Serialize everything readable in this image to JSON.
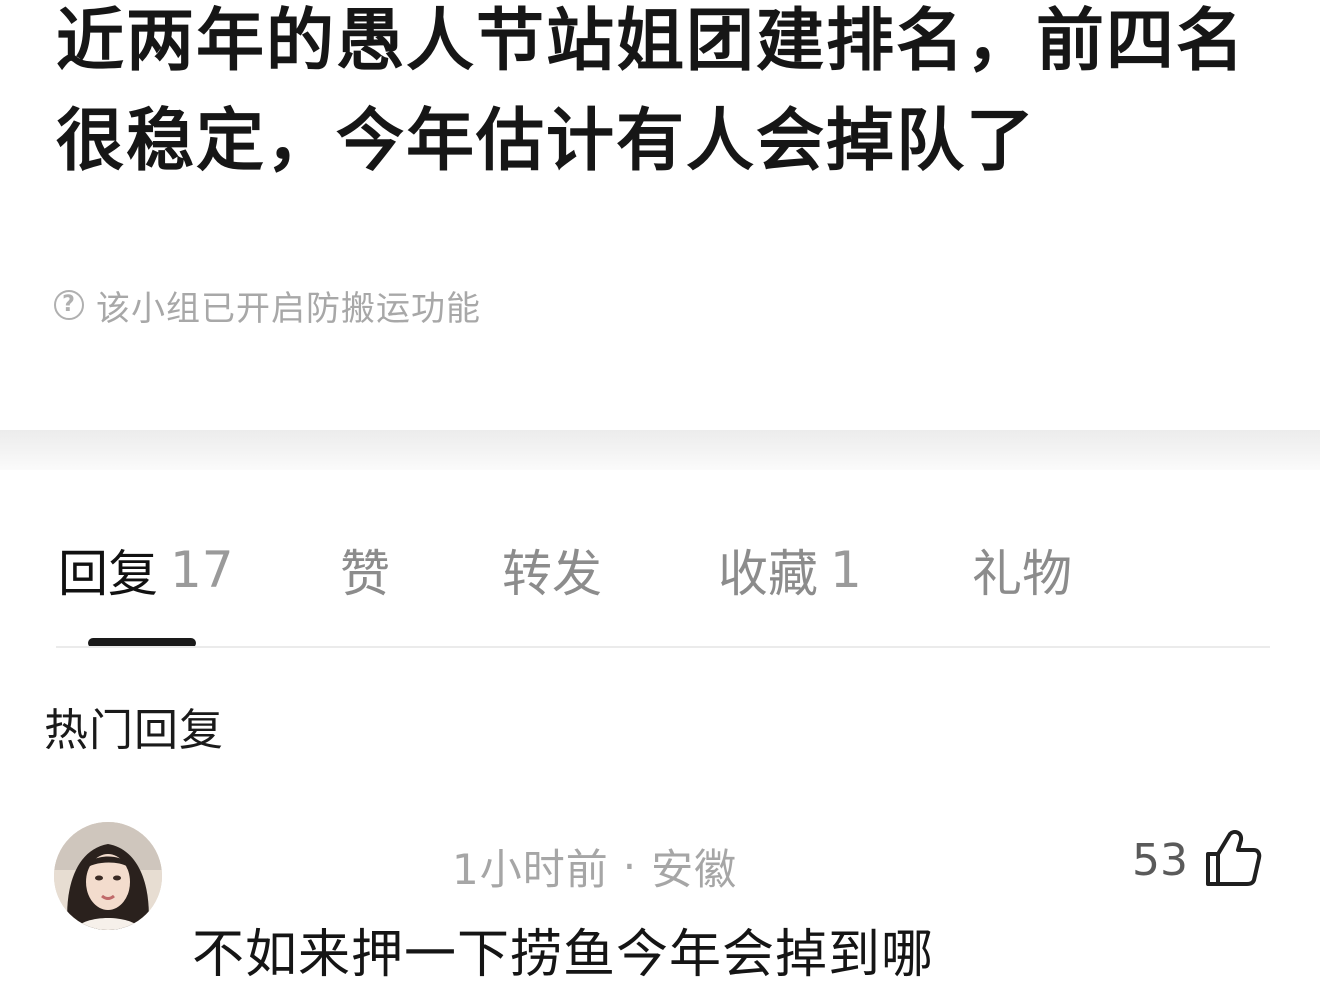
{
  "post": {
    "title": "近两年的愚人节站姐团建排名，前四名很稳定，今年估计有人会掉队了",
    "notice_icon": "question-circle-icon",
    "notice_text": "该小组已开启防搬运功能"
  },
  "tabs": [
    {
      "label": "回复",
      "count": "17",
      "active": true
    },
    {
      "label": "赞",
      "count": ""
    },
    {
      "label": "转发",
      "count": ""
    },
    {
      "label": "收藏",
      "count": "1"
    },
    {
      "label": "礼物",
      "count": ""
    }
  ],
  "hot_replies": {
    "header": "热门回复",
    "items": [
      {
        "meta_time": "1小时前",
        "meta_sep": "·",
        "meta_location": "安徽",
        "likes": "53",
        "like_icon": "thumbs-up-icon",
        "text": "不如来押一下捞鱼今年会掉到哪"
      }
    ]
  },
  "colors": {
    "text_primary": "#111111",
    "text_secondary": "#a6a6a6",
    "tab_inactive": "#8c8c8c",
    "underline": "#1a1a1a",
    "divider": "#ebebeb"
  }
}
